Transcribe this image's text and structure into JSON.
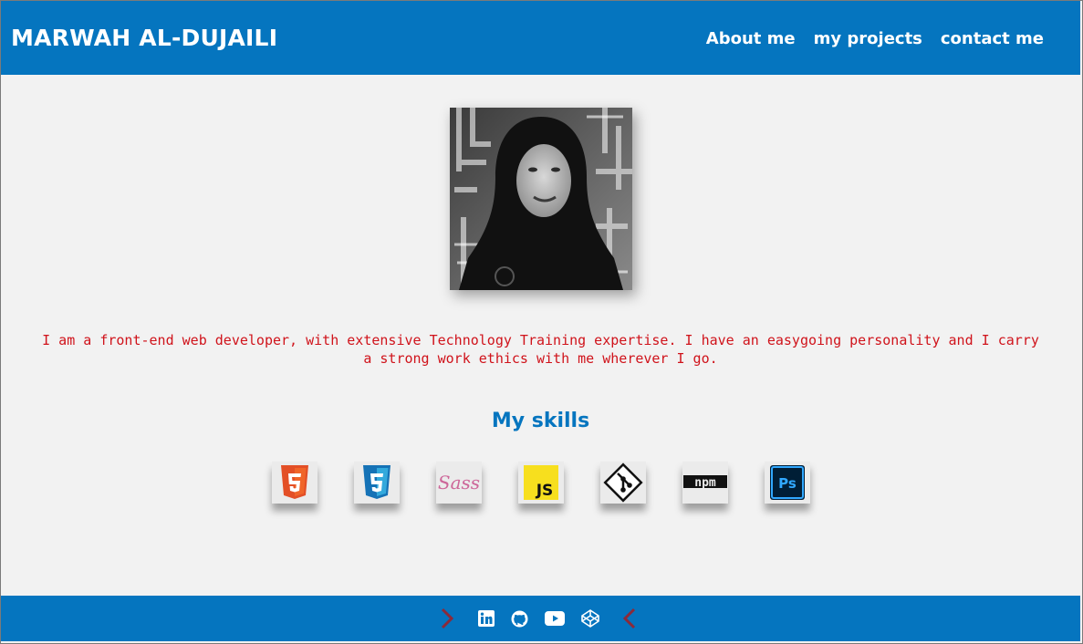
{
  "header": {
    "brand": "MARWAH AL-DUJAILI",
    "nav": [
      {
        "label": "About me"
      },
      {
        "label": "my projects"
      },
      {
        "label": "contact me"
      }
    ]
  },
  "main": {
    "bio": "I am a front-end web developer, with extensive Technology Training expertise. I have an easygoing personality and I carry a strong work ethics with me wherever I go.",
    "skills_title": "My skills",
    "skills": [
      {
        "name": "html5-icon"
      },
      {
        "name": "css3-icon"
      },
      {
        "name": "sass-icon",
        "text": "Sass"
      },
      {
        "name": "javascript-icon",
        "text": "JS"
      },
      {
        "name": "git-icon"
      },
      {
        "name": "npm-icon",
        "text": "npm"
      },
      {
        "name": "photoshop-icon",
        "text": "Ps"
      }
    ]
  },
  "footer": {
    "icons": [
      "chevron-right-icon",
      "linkedin-icon",
      "github-icon",
      "youtube-icon",
      "codepen-icon",
      "chevron-left-icon"
    ]
  },
  "colors": {
    "primary": "#0575bf",
    "background": "#f2f2f2",
    "bio_text": "#d0131b",
    "chevron": "#8b2a3a"
  }
}
